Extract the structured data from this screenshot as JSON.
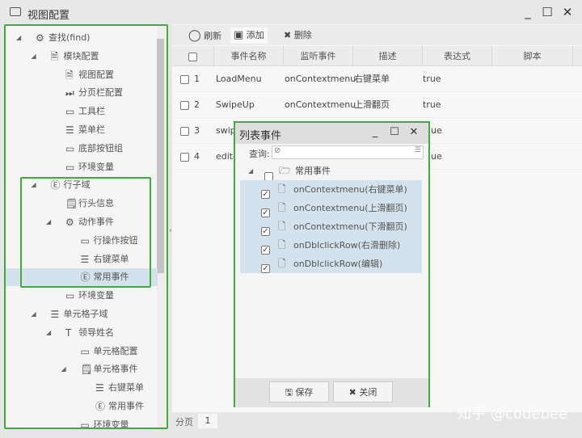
{
  "window": {
    "title": "视图配置",
    "minimize": "_",
    "maximize": "☐",
    "close": "✕"
  },
  "tree": [
    {
      "label": "查找(find)",
      "level": 0,
      "arrow": true,
      "icon": "gear-icon",
      "glyph": "⚙"
    },
    {
      "label": "模块配置",
      "level": 1,
      "arrow": true,
      "icon": "document-edit-icon",
      "glyph": "🗎"
    },
    {
      "label": "视图配置",
      "level": 2,
      "arrow": false,
      "icon": "document-edit-icon",
      "glyph": "🗎"
    },
    {
      "label": "分页栏配置",
      "level": 2,
      "arrow": false,
      "icon": "skip-forward-icon",
      "glyph": "⏭"
    },
    {
      "label": "工具栏",
      "level": 2,
      "arrow": false,
      "icon": "window-icon",
      "glyph": "▭"
    },
    {
      "label": "菜单栏",
      "level": 2,
      "arrow": false,
      "icon": "menu-lines-icon",
      "glyph": "☰"
    },
    {
      "label": "底部按钮组",
      "level": 2,
      "arrow": false,
      "icon": "panel-icon",
      "glyph": "▭"
    },
    {
      "label": "环境变量",
      "level": 2,
      "arrow": false,
      "icon": "rectangle-icon",
      "glyph": "▭"
    },
    {
      "label": "行子域",
      "level": 1,
      "arrow": true,
      "icon": "circle-e-icon",
      "glyph": "Ⓔ"
    },
    {
      "label": "行头信息",
      "level": 2,
      "arrow": false,
      "icon": "scroll-icon",
      "glyph": "🗒"
    },
    {
      "label": "动作事件",
      "level": 2,
      "arrow": true,
      "icon": "gear-icon",
      "glyph": "⚙"
    },
    {
      "label": "行操作按钮",
      "level": 3,
      "arrow": false,
      "icon": "window-icon",
      "glyph": "▭"
    },
    {
      "label": "右键菜单",
      "level": 3,
      "arrow": false,
      "icon": "menu-lines-icon",
      "glyph": "☰"
    },
    {
      "label": "常用事件",
      "level": 3,
      "arrow": false,
      "icon": "circle-e-icon",
      "glyph": "Ⓔ",
      "selected": true
    },
    {
      "label": "环境变量",
      "level": 2,
      "arrow": false,
      "icon": "rectangle-icon",
      "glyph": "▭"
    },
    {
      "label": "单元格子域",
      "level": 1,
      "arrow": true,
      "icon": "menu-lines-icon",
      "glyph": "☰"
    },
    {
      "label": "领导姓名",
      "level": 2,
      "arrow": true,
      "icon": "text-icon",
      "glyph": "T"
    },
    {
      "label": "单元格配置",
      "level": 3,
      "arrow": false,
      "icon": "window-icon",
      "glyph": "▭"
    },
    {
      "label": "单元格事件",
      "level": 3,
      "arrow": true,
      "icon": "scroll-icon",
      "glyph": "🗒"
    },
    {
      "label": "右键菜单",
      "level": 4,
      "arrow": false,
      "icon": "menu-lines-icon",
      "glyph": "☰"
    },
    {
      "label": "常用事件",
      "level": 4,
      "arrow": false,
      "icon": "circle-e-icon",
      "glyph": "Ⓔ"
    },
    {
      "label": "环境变量",
      "level": 3,
      "arrow": false,
      "icon": "rectangle-icon",
      "glyph": "▭"
    }
  ],
  "toolbar": {
    "refresh": "刷新",
    "add": "添加",
    "delete": "删除"
  },
  "grid": {
    "headers": [
      "事件名称",
      "监听事件",
      "描述",
      "表达式",
      "脚本"
    ],
    "rows": [
      {
        "no": "1",
        "name": "LoadMenu",
        "listen": "onContextmenu",
        "desc": "右键菜单",
        "expr": "true"
      },
      {
        "no": "2",
        "name": "SwipeUp",
        "listen": "onContextmenu",
        "desc": "上滑翻页",
        "expr": "true"
      },
      {
        "no": "3",
        "name": "swip",
        "listen": "",
        "desc": "",
        "expr": "ue"
      },
      {
        "no": "4",
        "name": "edito",
        "listen": "",
        "desc": "",
        "expr": "ue"
      }
    ]
  },
  "pager": {
    "label": "分页",
    "page": "1"
  },
  "dialog": {
    "title": "列表事件",
    "search_label": "查询:",
    "search_value": "",
    "root": "常用事件",
    "items": [
      "onContextmenu(右键菜单)",
      "onContextmenu(上滑翻页)",
      "onContextmenu(下滑翻页)",
      "onDblclickRow(右滑删除)",
      "onDblclickRow(编辑)"
    ],
    "save": "保存",
    "close": "关闭"
  },
  "watermark": "知乎 @codebee"
}
